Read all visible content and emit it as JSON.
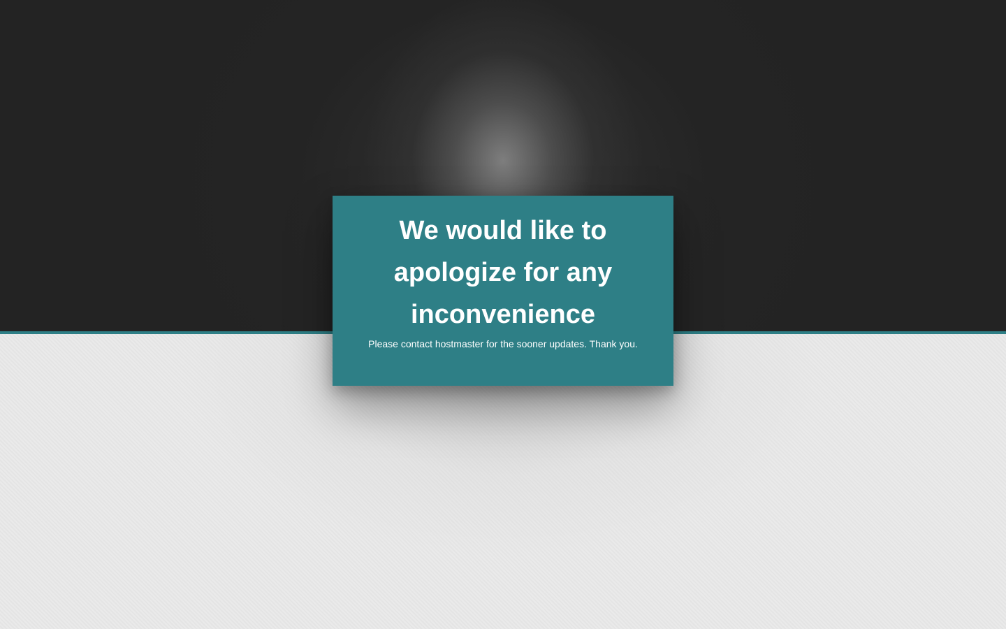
{
  "notice": {
    "title": "We would like to apologize for any inconvenience",
    "message": "Please contact hostmaster for the sooner updates. Thank you."
  },
  "colors": {
    "accent": "#2e7f86",
    "top_background": "#232323",
    "bottom_background": "#e9e9e9",
    "text": "#ffffff"
  }
}
